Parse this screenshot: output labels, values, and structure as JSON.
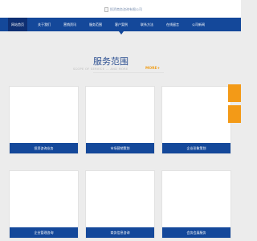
{
  "header": {
    "logo_alt": "投资商务咨询有限公司"
  },
  "nav": {
    "items": [
      {
        "label": "网站首页"
      },
      {
        "label": "关于我们"
      },
      {
        "label": "营销资讯"
      },
      {
        "label": "服务范围"
      },
      {
        "label": "客户案例"
      },
      {
        "label": "联系方法"
      },
      {
        "label": "在线留言"
      },
      {
        "label": "公司新闻"
      }
    ]
  },
  "services": {
    "title": "服务范围",
    "subtitle": "SCOPE OF SERVICE ... AND MORE",
    "more_label": "MORE+",
    "cards": [
      {
        "label": "投资咨询业务"
      },
      {
        "label": "市场营销策划"
      },
      {
        "label": "企业形象策划"
      },
      {
        "label": "企业管理咨询"
      },
      {
        "label": "商务信息咨询"
      },
      {
        "label": "会务会展服务"
      }
    ]
  },
  "colors": {
    "nav_bg": "#14489a",
    "accent": "#f39a17",
    "page_bg": "#ececec"
  }
}
